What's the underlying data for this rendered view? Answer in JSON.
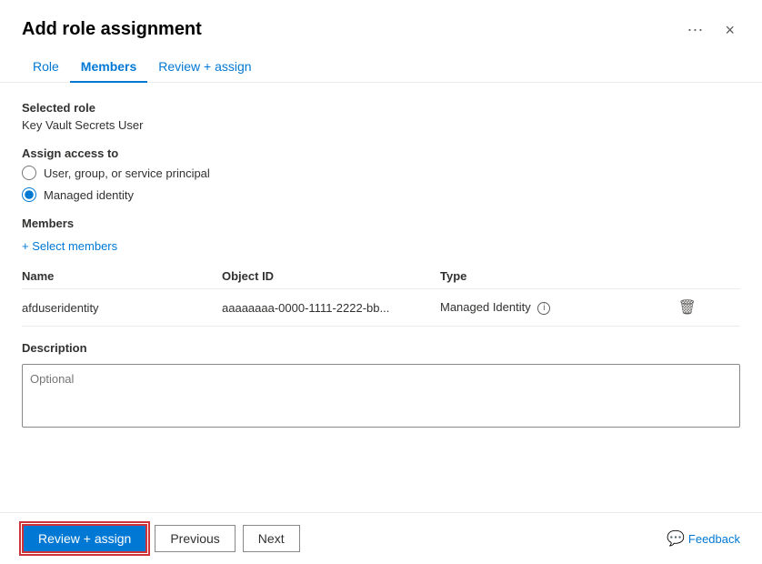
{
  "dialog": {
    "title": "Add role assignment",
    "close_label": "×",
    "ellipsis_label": "···"
  },
  "tabs": [
    {
      "id": "role",
      "label": "Role",
      "active": false
    },
    {
      "id": "members",
      "label": "Members",
      "active": true
    },
    {
      "id": "review",
      "label": "Review + assign",
      "active": false
    }
  ],
  "body": {
    "selected_role_label": "Selected role",
    "selected_role_value": "Key Vault Secrets User",
    "assign_access_label": "Assign access to",
    "radio_options": [
      {
        "id": "user",
        "label": "User, group, or service principal",
        "checked": false
      },
      {
        "id": "managed",
        "label": "Managed identity",
        "checked": true
      }
    ],
    "members_label": "Members",
    "select_members_label": "+ Select members",
    "table": {
      "columns": [
        "Name",
        "Object ID",
        "Type"
      ],
      "rows": [
        {
          "name": "afduseridentity",
          "object_id": "aaaaaaaa-0000-1111-2222-bb...",
          "type": "Managed Identity"
        }
      ]
    },
    "description_label": "Description",
    "description_placeholder": "Optional"
  },
  "footer": {
    "review_assign_label": "Review + assign",
    "previous_label": "Previous",
    "next_label": "Next",
    "feedback_label": "Feedback"
  }
}
